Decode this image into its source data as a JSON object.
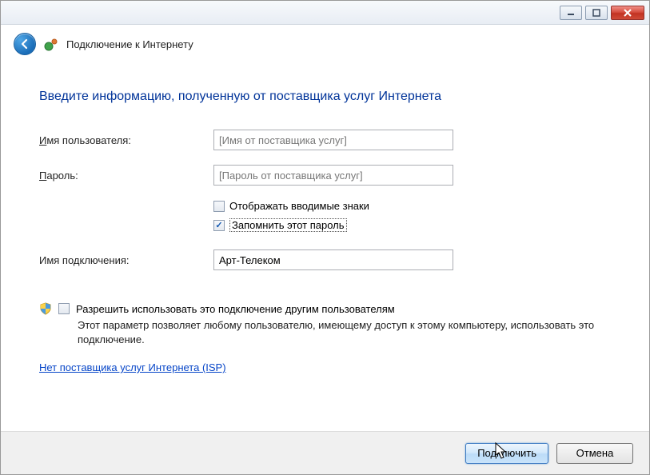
{
  "window": {
    "title": "Подключение к Интернету"
  },
  "heading": "Введите информацию, полученную от поставщика услуг Интернета",
  "labels": {
    "username_pre": "И",
    "username_rest": "мя пользователя:",
    "password_pre": "П",
    "password_rest": "ароль:",
    "connection_name": "Имя подключения:"
  },
  "inputs": {
    "username_placeholder": "[Имя от поставщика услуг]",
    "password_placeholder": "[Пароль от поставщика услуг]",
    "connection_value": "Арт-Телеком"
  },
  "checkboxes": {
    "show_chars_pre": "Отобра",
    "show_chars_u": "ж",
    "show_chars_rest": "ать вводимые знаки",
    "remember_pre": "",
    "remember_u": "З",
    "remember_rest": "апомнить этот пароль"
  },
  "allow": {
    "text_pre": "",
    "text_u": "Р",
    "text_rest": "азрешить использовать это подключение другим пользователям",
    "desc": "Этот параметр позволяет любому пользователю, имеющему доступ к этому компьютеру, использовать это подключение."
  },
  "isp_link": "Нет поставщика услуг Интернета (ISP)",
  "buttons": {
    "connect_pre": "Подкл",
    "connect_u": "ю",
    "connect_rest": "чить",
    "cancel": "Отмена"
  }
}
